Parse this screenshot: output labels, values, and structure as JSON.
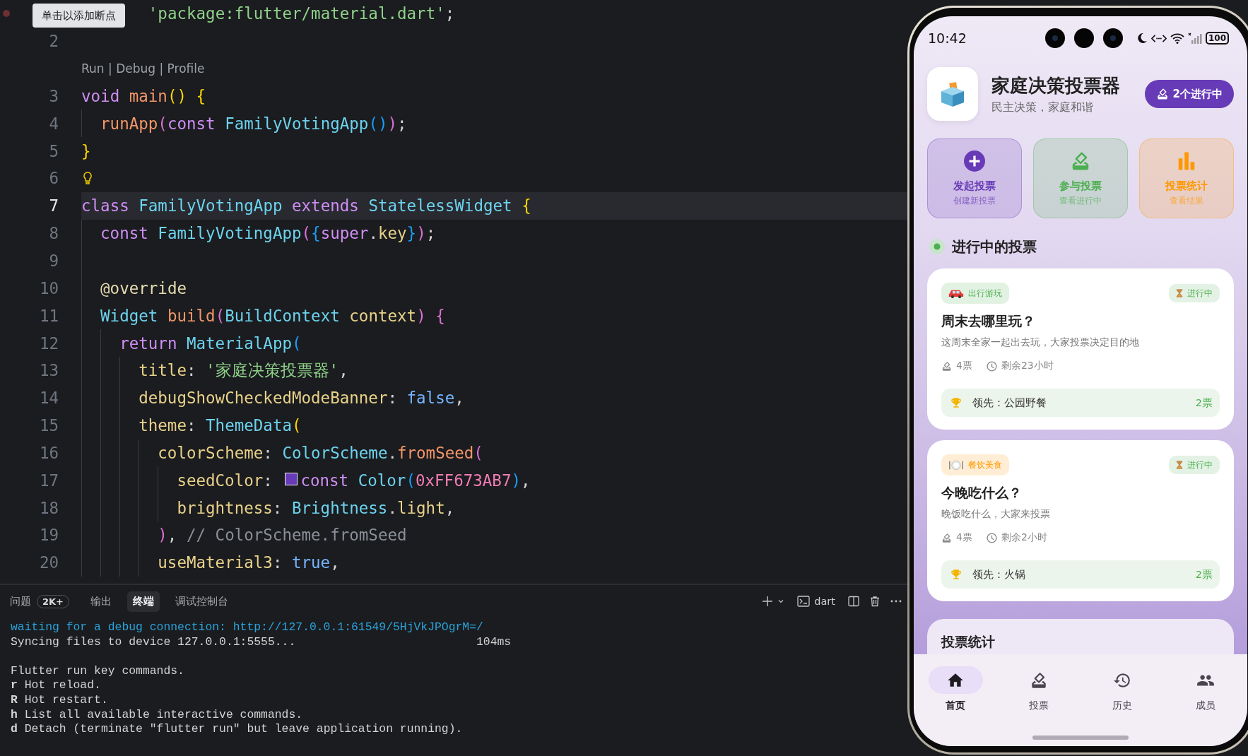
{
  "editor": {
    "tooltip": "单击以添加断点",
    "lines": [
      {
        "breakpoint": true,
        "tokens": [
          {
            "t": "'package:flutter/material.dart'",
            "color": "#8fd18a"
          },
          {
            "t": ";",
            "color": "#d4d4d4"
          }
        ]
      },
      {
        "number": "2"
      },
      {
        "number": "3",
        "codelens": "Run | Debug | Profile",
        "tokens": [
          {
            "t": "void ",
            "color": "#cf8ef4"
          },
          {
            "t": "main",
            "color": "#f29668"
          },
          {
            "t": "() {",
            "color": "#ffd700"
          }
        ],
        "children": [
          {
            "number": "4",
            "tokens": [
              {
                "t": "runApp",
                "color": "#f29668"
              },
              {
                "t": "(",
                "color": "#da70d6"
              },
              {
                "t": "const ",
                "color": "#cf8ef4"
              },
              {
                "t": "FamilyVotingApp",
                "color": "#6cd3ee"
              },
              {
                "t": "()",
                "color": "#179fff"
              },
              {
                "t": ")",
                "color": "#da70d6"
              },
              {
                "t": ";",
                "color": "#d4d4d4"
              }
            ]
          }
        ]
      },
      {
        "number": "5",
        "tokens": [
          {
            "t": "}",
            "color": "#ffd700"
          }
        ]
      },
      {
        "number": "6",
        "lightbulb": true
      },
      {
        "number": "7",
        "current": true,
        "tokens": [
          {
            "t": "class ",
            "color": "#cf8ef4"
          },
          {
            "t": "FamilyVotingApp ",
            "color": "#6cd3ee"
          },
          {
            "t": "extends ",
            "color": "#cf8ef4"
          },
          {
            "t": "StatelessWidget ",
            "color": "#6cd3ee"
          },
          {
            "t": "{",
            "color": "#ffd700"
          }
        ],
        "children": [
          {
            "number": "8",
            "tokens": [
              {
                "t": "const ",
                "color": "#cf8ef4"
              },
              {
                "t": "FamilyVotingApp",
                "color": "#6cd3ee"
              },
              {
                "t": "(",
                "color": "#da70d6"
              },
              {
                "t": "{",
                "color": "#179fff"
              },
              {
                "t": "super",
                "color": "#cf8ef4"
              },
              {
                "t": ".",
                "color": "#d4d4d4"
              },
              {
                "t": "key",
                "color": "#e8d28a"
              },
              {
                "t": "}",
                "color": "#179fff"
              },
              {
                "t": ")",
                "color": "#da70d6"
              },
              {
                "t": ";",
                "color": "#d4d4d4"
              }
            ]
          },
          {
            "number": "9"
          },
          {
            "number": "10",
            "tokens": [
              {
                "t": "@override",
                "color": "#e6dcb0"
              }
            ]
          },
          {
            "number": "11",
            "tokens": [
              {
                "t": "Widget ",
                "color": "#6cd3ee"
              },
              {
                "t": "build",
                "color": "#f29668"
              },
              {
                "t": "(",
                "color": "#da70d6"
              },
              {
                "t": "BuildContext ",
                "color": "#6cd3ee"
              },
              {
                "t": "context",
                "color": "#e8d28a"
              },
              {
                "t": ") {",
                "color": "#da70d6"
              }
            ],
            "children": [
              {
                "number": "12",
                "tokens": [
                  {
                    "t": "return ",
                    "color": "#cf8ef4"
                  },
                  {
                    "t": "MaterialApp",
                    "color": "#6cd3ee"
                  },
                  {
                    "t": "(",
                    "color": "#179fff"
                  }
                ],
                "children": [
                  {
                    "number": "13",
                    "tokens": [
                      {
                        "t": "title",
                        "color": "#e8d28a"
                      },
                      {
                        "t": ": ",
                        "color": "#d4d4d4"
                      },
                      {
                        "t": "'家庭决策投票器'",
                        "color": "#8fd18a"
                      },
                      {
                        "t": ",",
                        "color": "#d4d4d4"
                      }
                    ]
                  },
                  {
                    "number": "14",
                    "tokens": [
                      {
                        "t": "debugShowCheckedModeBanner",
                        "color": "#e8d28a"
                      },
                      {
                        "t": ": ",
                        "color": "#d4d4d4"
                      },
                      {
                        "t": "false",
                        "color": "#74b4ff"
                      },
                      {
                        "t": ",",
                        "color": "#d4d4d4"
                      }
                    ]
                  },
                  {
                    "number": "15",
                    "tokens": [
                      {
                        "t": "theme",
                        "color": "#e8d28a"
                      },
                      {
                        "t": ": ",
                        "color": "#d4d4d4"
                      },
                      {
                        "t": "ThemeData",
                        "color": "#6cd3ee"
                      },
                      {
                        "t": "(",
                        "color": "#ffd700"
                      }
                    ],
                    "children": [
                      {
                        "number": "16",
                        "tokens": [
                          {
                            "t": "colorScheme",
                            "color": "#e8d28a"
                          },
                          {
                            "t": ": ",
                            "color": "#d4d4d4"
                          },
                          {
                            "t": "ColorScheme",
                            "color": "#6cd3ee"
                          },
                          {
                            "t": ".",
                            "color": "#d4d4d4"
                          },
                          {
                            "t": "fromSeed",
                            "color": "#f29668"
                          },
                          {
                            "t": "(",
                            "color": "#da70d6"
                          }
                        ],
                        "children": [
                          {
                            "number": "17",
                            "tokens": [
                              {
                                "t": "seedColor",
                                "color": "#e8d28a"
                              },
                              {
                                "t": ": ",
                                "color": "#d4d4d4"
                              },
                              {
                                "color": "#673ab7"
                              },
                              {
                                "t": "const ",
                                "color": "#cf8ef4"
                              },
                              {
                                "t": "Color",
                                "color": "#6cd3ee"
                              },
                              {
                                "t": "(",
                                "color": "#179fff"
                              },
                              {
                                "t": "0xFF673AB7",
                                "color": "#f07cb4"
                              },
                              {
                                "t": ")",
                                "color": "#179fff"
                              },
                              {
                                "t": ",",
                                "color": "#d4d4d4"
                              }
                            ]
                          },
                          {
                            "number": "18",
                            "tokens": [
                              {
                                "t": "brightness",
                                "color": "#e8d28a"
                              },
                              {
                                "t": ": ",
                                "color": "#d4d4d4"
                              },
                              {
                                "t": "Brightness",
                                "color": "#6cd3ee"
                              },
                              {
                                "t": ".",
                                "color": "#d4d4d4"
                              },
                              {
                                "t": "light",
                                "color": "#e8d28a"
                              },
                              {
                                "t": ",",
                                "color": "#d4d4d4"
                              }
                            ]
                          }
                        ]
                      },
                      {
                        "number": "19",
                        "tokens": [
                          {
                            "t": ")",
                            "color": "#da70d6"
                          },
                          {
                            "t": ", ",
                            "color": "#d4d4d4"
                          },
                          {
                            "t": "// ColorScheme.fromSeed",
                            "color": "#8a8f98"
                          }
                        ]
                      },
                      {
                        "number": "20",
                        "tokens": [
                          {
                            "t": "useMaterial3",
                            "color": "#e8d28a"
                          },
                          {
                            "t": ": ",
                            "color": "#d4d4d4"
                          },
                          {
                            "t": "true",
                            "color": "#74b4ff"
                          },
                          {
                            "t": ",",
                            "color": "#d4d4d4"
                          }
                        ]
                      }
                    ]
                  }
                ]
              }
            ]
          }
        ]
      }
    ]
  },
  "panel": {
    "tabs": [
      {
        "label": "问题",
        "badge": "2K+",
        "selected": false
      },
      {
        "label": "输出",
        "selected": false
      },
      {
        "label": "终端",
        "selected": true
      },
      {
        "label": "调试控制台",
        "selected": false
      }
    ],
    "terminal_label": "dart",
    "terminal_lines": [
      {
        "kind": "info",
        "text": "waiting for a debug connection: http://127.0.0.1:61549/5HjVkJPOgrM=/"
      },
      {
        "kind": "plain",
        "text": "Syncing files to device 127.0.0.1:5555...                          104ms"
      },
      {
        "kind": "blank"
      },
      {
        "kind": "plain",
        "text": "Flutter run key commands."
      },
      {
        "kind": "plain",
        "text": "**r** Hot reload."
      },
      {
        "kind": "plain",
        "text": "**R** Hot restart."
      },
      {
        "kind": "plain",
        "text": "**h** List all available interactive commands."
      },
      {
        "kind": "plain",
        "text": "**d** Detach (terminate \"flutter run\" but leave application running)."
      }
    ]
  },
  "phone": {
    "status_bar": {
      "time": "10:42",
      "battery": "100"
    },
    "header": {
      "title": "家庭决策投票器",
      "subtitle": "民主决策，家庭和谐",
      "badge": "2个进行中"
    },
    "actions": [
      {
        "kind": "create",
        "title": "发起投票",
        "subtitle": "创建新投票",
        "color": "#673ab7"
      },
      {
        "kind": "join",
        "title": "参与投票",
        "subtitle": "查看进行中",
        "color": "#4caf50"
      },
      {
        "kind": "stats",
        "title": "投票统计",
        "subtitle": "查看结果",
        "color": "#ff9800"
      }
    ],
    "section_title": "进行中的投票",
    "polls": [
      {
        "category": "出行游玩",
        "kind": "travel",
        "color": "#4caf50",
        "status": "进行中",
        "title": "周末去哪里玩？",
        "description": "这周末全家一起出去玩，大家投票决定目的地",
        "votes": "4票",
        "remaining": "剩余23小时",
        "leader": "领先：公园野餐",
        "leader_votes": "2票"
      },
      {
        "category": "餐饮美食",
        "kind": "food",
        "color": "#ff9800",
        "status": "进行中",
        "title": "今晚吃什么？",
        "description": "晚饭吃什么，大家来投票",
        "votes": "4票",
        "remaining": "剩余2小时",
        "leader": "领先：火锅",
        "leader_votes": "2票"
      }
    ],
    "stats_card_title": "投票统计",
    "nav": [
      {
        "kind": "home",
        "label": "首页",
        "selected": true
      },
      {
        "kind": "vote",
        "label": "投票",
        "selected": false
      },
      {
        "kind": "history",
        "label": "历史",
        "selected": false
      },
      {
        "kind": "members",
        "label": "成员",
        "selected": false
      }
    ]
  }
}
